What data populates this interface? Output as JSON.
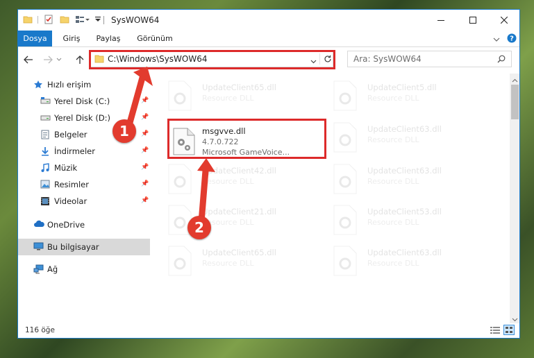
{
  "window": {
    "title": "SysWOW64",
    "controls": [
      "minimize-icon",
      "maximize-icon",
      "close-icon"
    ]
  },
  "ribbon": {
    "tabs": [
      "Dosya",
      "Giriş",
      "Paylaş",
      "Görünüm"
    ]
  },
  "address_bar": {
    "path": "C:\\Windows\\SysWOW64"
  },
  "search": {
    "placeholder": "Ara: SysWOW64"
  },
  "sidebar": {
    "items": [
      {
        "label": "Hızlı erişim",
        "icon": "star-icon"
      },
      {
        "label": "Yerel Disk (C:)",
        "icon": "drive-icon"
      },
      {
        "label": "Yerel Disk (D:)",
        "icon": "drive-icon"
      },
      {
        "label": "Belgeler",
        "icon": "documents-icon"
      },
      {
        "label": "İndirmeler",
        "icon": "download-icon"
      },
      {
        "label": "Müzik",
        "icon": "music-icon"
      },
      {
        "label": "Resimler",
        "icon": "pictures-icon"
      },
      {
        "label": "Videolar",
        "icon": "video-icon"
      },
      {
        "label": "OneDrive",
        "icon": "cloud-icon"
      },
      {
        "label": "Bu bilgisayar",
        "icon": "computer-icon"
      },
      {
        "label": "Ağ",
        "icon": "network-icon"
      }
    ]
  },
  "files": [
    {
      "name": "UpdateClient65.dll",
      "desc": "Resource DLL"
    },
    {
      "name": "UpdateClient5.dll",
      "desc": "Resource DLL"
    },
    {
      "name": "msgvve.dll",
      "version": "4.7.0.722",
      "desc": "Microsoft GameVoice..."
    },
    {
      "name": "UpdateClient63.dll",
      "desc": "Resource DLL"
    },
    {
      "name": "UpdateClient42.dll",
      "desc": "Resource DLL"
    },
    {
      "name": "UpdateClient63.dll",
      "desc": "Resource DLL"
    },
    {
      "name": "UpdateClient21.dll",
      "desc": "Resource DLL"
    },
    {
      "name": "UpdateClient53.dll",
      "desc": "Resource DLL"
    },
    {
      "name": "UpdateClient65.dll",
      "desc": "Resource DLL"
    },
    {
      "name": "UpdateClient63.dll",
      "desc": "Resource DLL"
    }
  ],
  "status": {
    "count": "116 öğe"
  },
  "annotations": {
    "badge1": "1",
    "badge2": "2",
    "color": "#dd2a2a"
  },
  "colors": {
    "accent": "#1979ca",
    "selection": "#cce8ff"
  }
}
